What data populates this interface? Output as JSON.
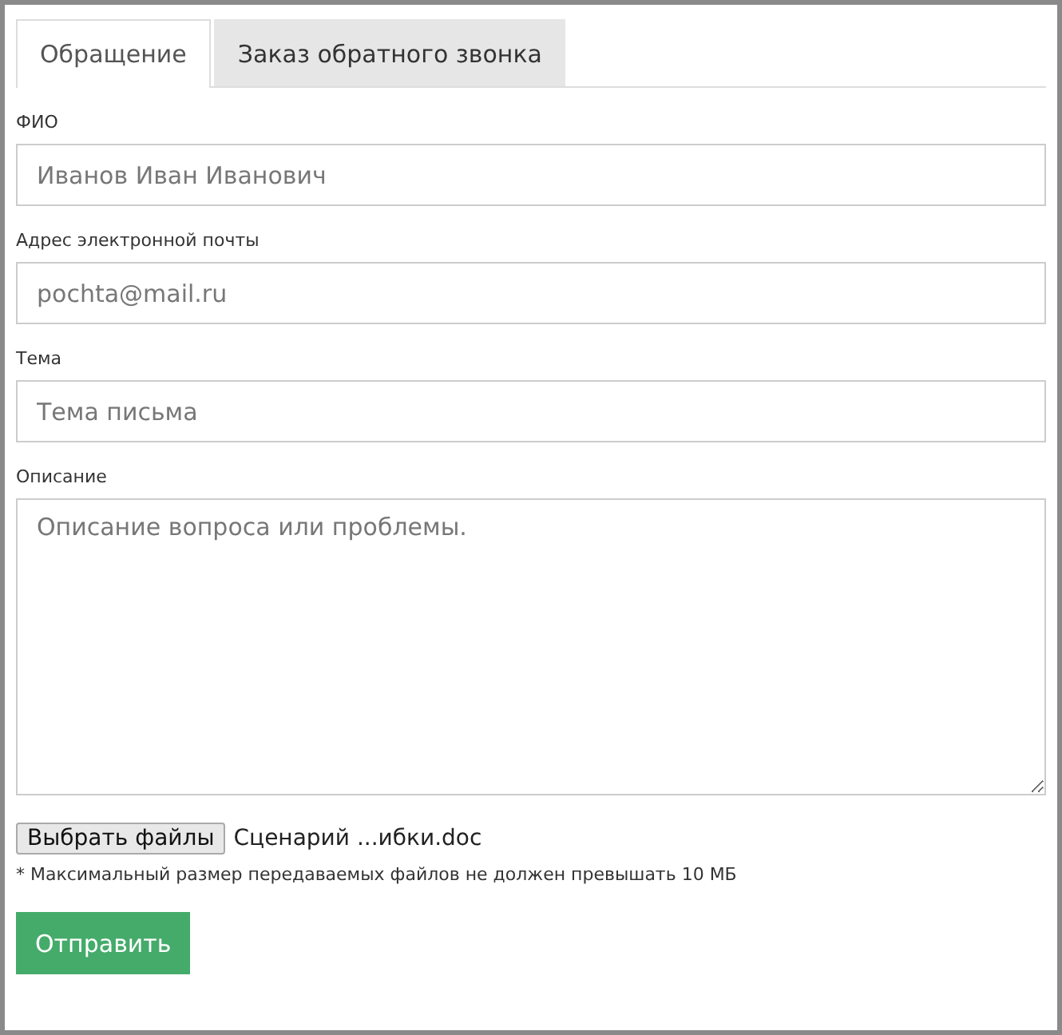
{
  "tabs": [
    {
      "label": "Обращение",
      "selected": true
    },
    {
      "label": "Заказ обратного звонка",
      "selected": false
    }
  ],
  "fields": [
    {
      "kind": "input",
      "label": "ФИО",
      "placeholder": "Иванов Иван Иванович"
    },
    {
      "kind": "input",
      "label": "Адрес электронной почты",
      "placeholder": "pochta@mail.ru"
    },
    {
      "kind": "input",
      "label": "Тема",
      "placeholder": "Тема письма"
    },
    {
      "kind": "textarea",
      "label": "Описание",
      "placeholder": "Описание вопроса или проблемы."
    }
  ],
  "file_picker": {
    "button": "Выбрать файлы",
    "file_name": "Сценарий ...ибки.doc"
  },
  "note": "* Максимальный размер передаваемых файлов не должен превышать 10 МБ",
  "submit": "Отправить"
}
